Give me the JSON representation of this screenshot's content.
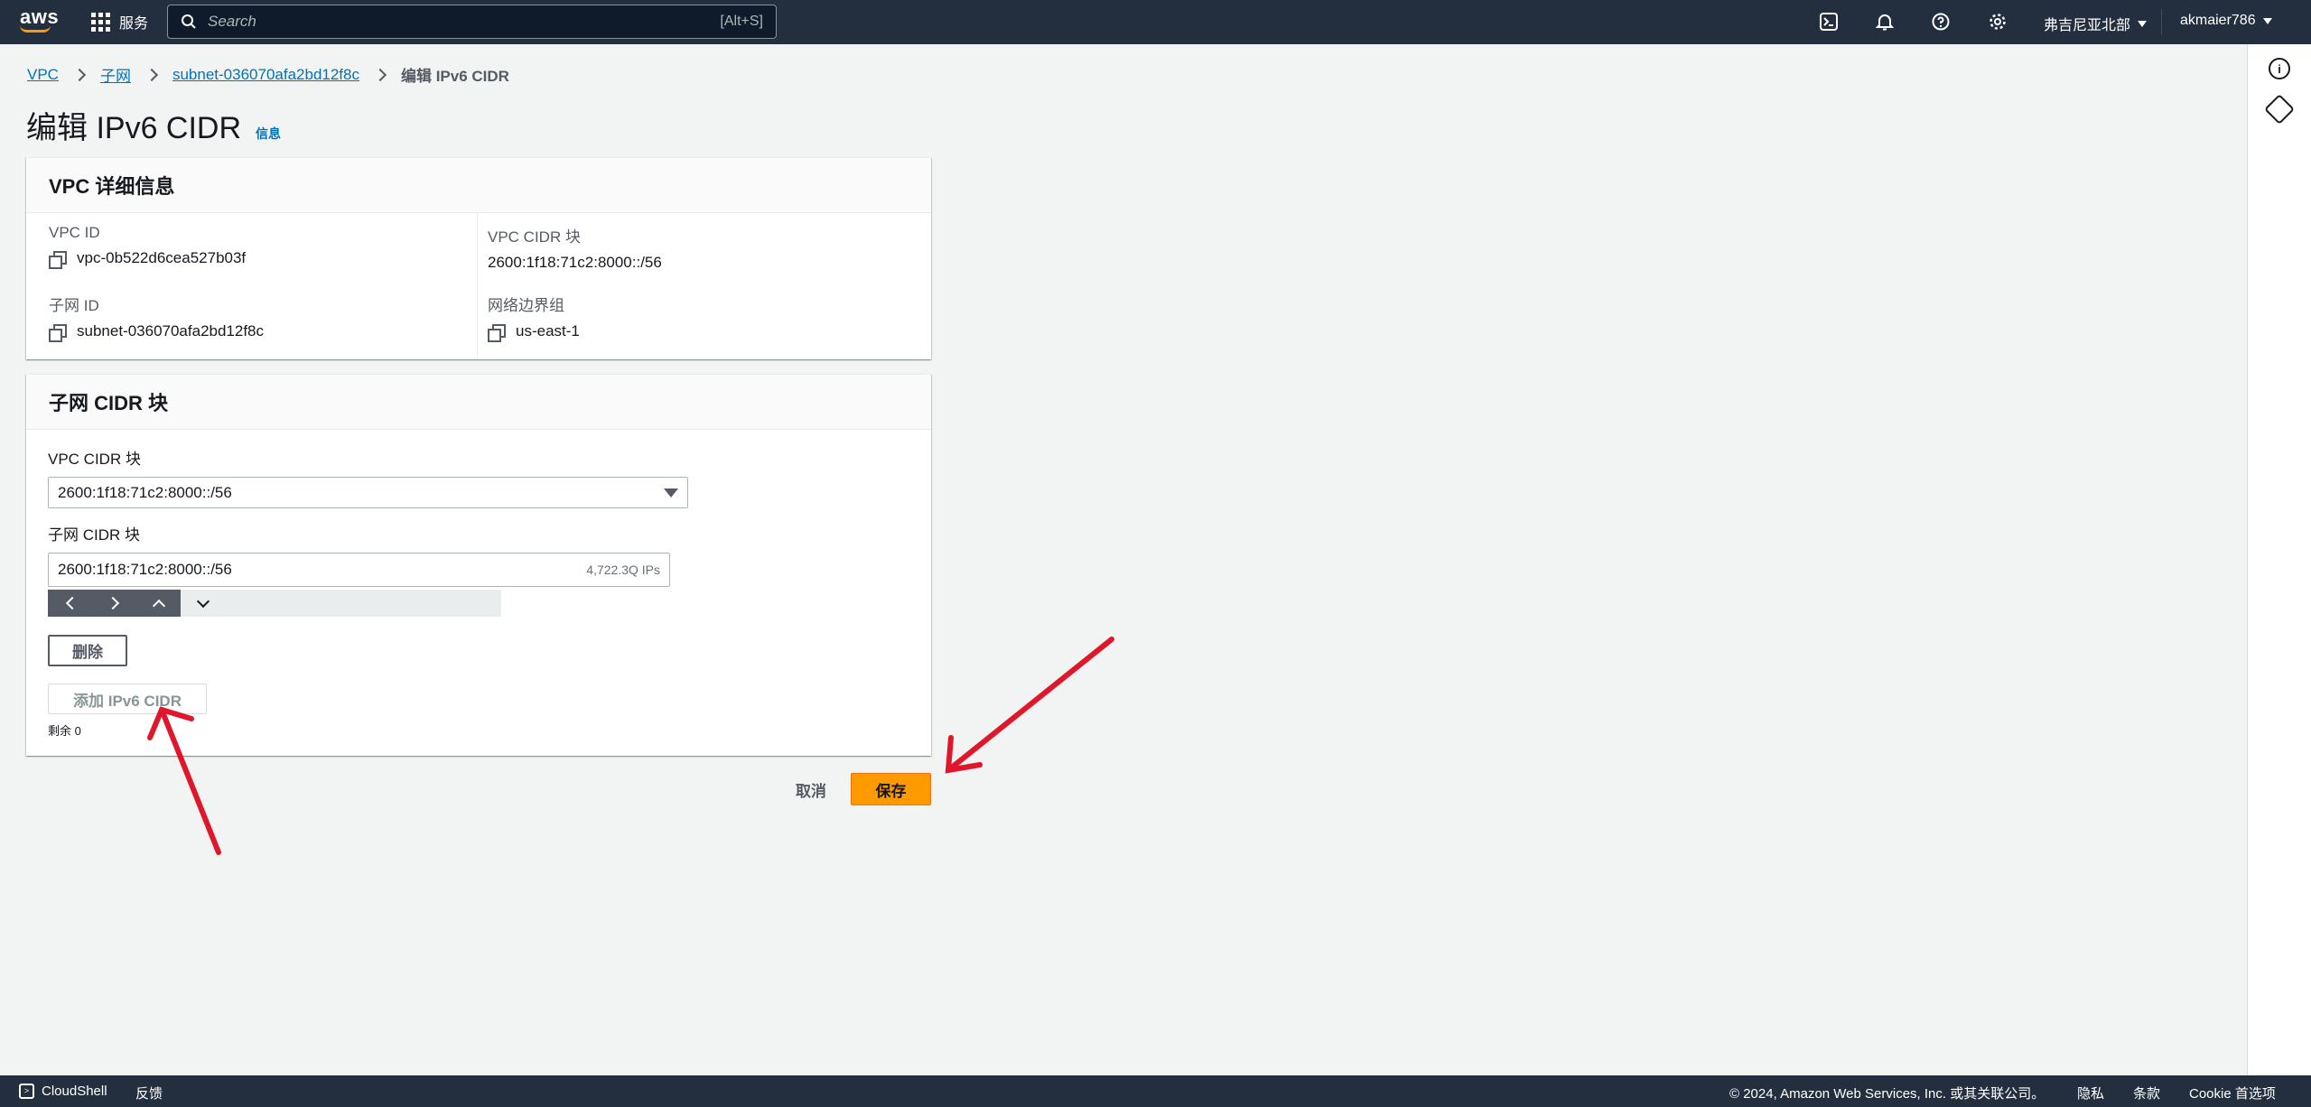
{
  "topnav": {
    "logo_text": "aws",
    "services_label": "服务",
    "search_placeholder": "Search",
    "search_shortcut": "[Alt+S]",
    "region_label": "弗吉尼亚北部",
    "account_label": "akmaier786"
  },
  "breadcrumb": {
    "items": [
      "VPC",
      "子网",
      "subnet-036070afa2bd12f8c"
    ],
    "current": "编辑 IPv6 CIDR"
  },
  "page": {
    "title": "编辑 IPv6 CIDR",
    "info_label": "信息"
  },
  "vpc_details": {
    "title": "VPC 详细信息",
    "vpc_id_label": "VPC ID",
    "vpc_id_value": "vpc-0b522d6cea527b03f",
    "subnet_id_label": "子网 ID",
    "subnet_id_value": "subnet-036070afa2bd12f8c",
    "vpc_cidr_label": "VPC CIDR 块",
    "vpc_cidr_value": "2600:1f18:71c2:8000::/56",
    "border_group_label": "网络边界组",
    "border_group_value": "us-east-1"
  },
  "subnet_cidr": {
    "title": "子网 CIDR 块",
    "vpc_cidr_select_label": "VPC CIDR 块",
    "vpc_cidr_select_value": "2600:1f18:71c2:8000::/56",
    "subnet_cidr_label": "子网 CIDR 块",
    "subnet_cidr_value": "2600:1f18:71c2:8000::/56",
    "ip_count": "4,722.3Q IPs",
    "remove_label": "删除",
    "add_label": "添加 IPv6 CIDR",
    "remaining_label": "剩余 0"
  },
  "actions": {
    "cancel_label": "取消",
    "save_label": "保存"
  },
  "footer": {
    "cloudshell_label": "CloudShell",
    "feedback_label": "反馈",
    "copyright": "© 2024, Amazon Web Services, Inc. 或其关联公司。",
    "privacy_label": "隐私",
    "terms_label": "条款",
    "cookie_label": "Cookie 首选项"
  },
  "colors": {
    "nav_bg": "#232f3e",
    "primary_button": "#ff9900",
    "link": "#0073bb",
    "annotation_arrow": "#e0162b"
  }
}
